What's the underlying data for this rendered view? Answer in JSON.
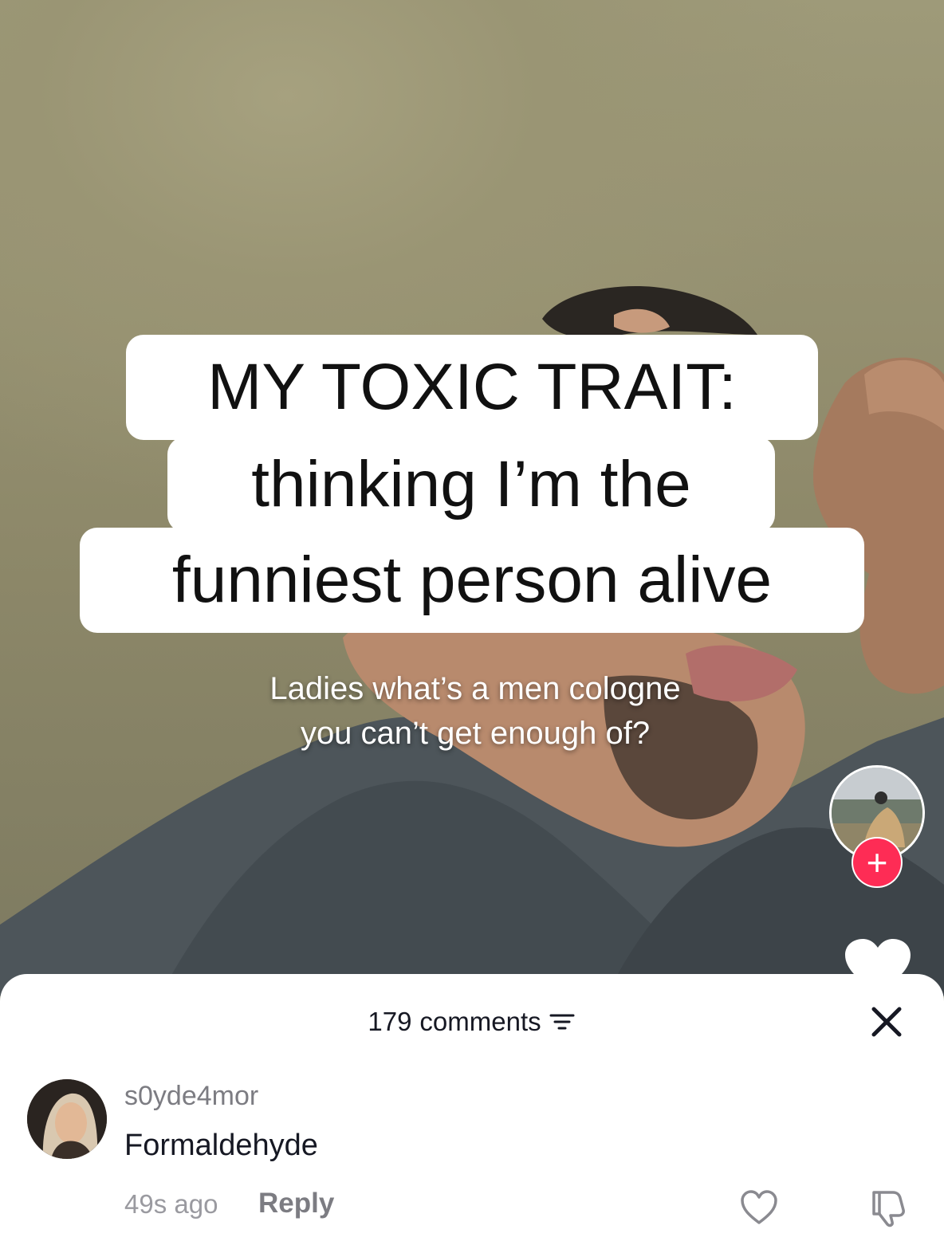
{
  "video": {
    "caption_lines": [
      "MY TOXIC TRAIT:",
      "thinking I’m the",
      "funniest person alive"
    ],
    "subtitle_lines": [
      "Ladies what’s a men cologne",
      "you can’t get enough of?"
    ],
    "follow_icon": "+",
    "accent_color": "#fe2c55"
  },
  "comments_panel": {
    "count": "179",
    "count_label": "comments",
    "sort_icon": "sort-icon",
    "close_icon": "close-icon"
  },
  "comments": [
    {
      "username": "s0yde4mor",
      "text": "Formaldehyde",
      "time": "49s ago",
      "reply_label": "Reply"
    }
  ]
}
